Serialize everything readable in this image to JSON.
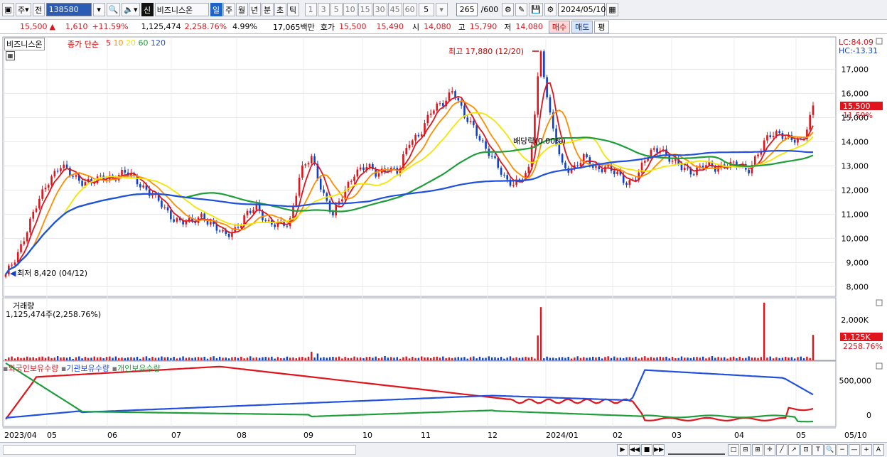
{
  "toolbar": {
    "period_unit": "주",
    "prev_label": "전",
    "code": "138580",
    "stock_name_badge": "신",
    "stock_name": "비즈니스온",
    "periods": [
      "일",
      "주",
      "월",
      "년",
      "분",
      "초",
      "틱"
    ],
    "selected_period": "일",
    "intervals": [
      "1",
      "3",
      "5",
      "10",
      "15",
      "30",
      "45",
      "60"
    ],
    "interval_value": "5",
    "count_value": "265",
    "count_total": "/600",
    "date": "2024/05/10"
  },
  "quote": {
    "price": "15,500",
    "up_arrow": "▲",
    "change": "1,610",
    "change_pct": "+11.59%",
    "volume": "1,125,474",
    "volume_pct": "2,258.76%",
    "turnover_pct": "4.99%",
    "amount": "17,065백만",
    "ask_label": "호가",
    "ask": "15,500",
    "bid": "15,490",
    "open_label": "시",
    "open": "14,080",
    "high_label": "고",
    "high": "15,790",
    "low_label": "저",
    "low": "14,080",
    "buy_label": "매수",
    "sell_label": "매도",
    "eval_label": "평"
  },
  "price_panel": {
    "stock_label": "비즈니스온",
    "ma_title": "종가 단순",
    "ma_periods": [
      "5",
      "10",
      "20",
      "60",
      "120"
    ],
    "ma_colors": [
      "#e0141c",
      "#ff8c00",
      "#f2e600",
      "#1e9e3a",
      "#2050e0"
    ],
    "lc": "LC:84.09",
    "hc": "HC:-13.31",
    "max_note": "최고 17,880 (12/20)",
    "min_note": "최저 8,420 (04/12)",
    "dividend_note": "배당락(0.00%)",
    "last_price_tag": "15,500",
    "last_pct_tag": "11.59%",
    "y_ticks": [
      "17,000",
      "16,000",
      "15,000",
      "14,000",
      "13,000",
      "12,000",
      "11,000",
      "10,000",
      "9,000",
      "8,000"
    ]
  },
  "volume_panel": {
    "title": "거래량",
    "value_text": "1,125,474주(2,258.76%)",
    "y_tick": "2,000K",
    "last_tag": "1,125K",
    "last_pct": "2258.76%"
  },
  "holdings_panel": {
    "legend": [
      "외국인보유수량",
      "기관보유수량",
      "개인보유수량"
    ],
    "legend_colors": [
      "#e0141c",
      "#2050e0",
      "#1e9e3a"
    ],
    "y_ticks": [
      "500,000",
      "0"
    ]
  },
  "x_axis": [
    "2023/04",
    "05",
    "06",
    "07",
    "08",
    "09",
    "10",
    "11",
    "12",
    "2024/01",
    "02",
    "03",
    "04",
    "05",
    "05/10"
  ],
  "chart_data": {
    "type": "candlestick",
    "ylim": [
      7600,
      18100
    ],
    "close_approx": [
      8420,
      9300,
      10400,
      11500,
      12500,
      13000,
      12600,
      12400,
      12300,
      12500,
      12600,
      12700,
      12400,
      12000,
      11500,
      11000,
      10700,
      10600,
      11000,
      10500,
      10100,
      10400,
      10900,
      11300,
      10700,
      10500,
      10600,
      12800,
      13300,
      12000,
      11000,
      11800,
      12800,
      13000,
      12600,
      13000,
      12700,
      14000,
      14400,
      15200,
      15600,
      16200,
      15000,
      14600,
      13700,
      13000,
      12400,
      12300,
      12800,
      17880,
      14700,
      13000,
      12900,
      13300,
      12900,
      13000,
      12600,
      12300,
      12700,
      13500,
      13800,
      13200,
      12900,
      12800,
      13000,
      12900,
      13100,
      13000,
      12800,
      13600,
      14200,
      14400,
      14100,
      13900,
      15500
    ],
    "series": [
      {
        "name": "종가 단순 5"
      },
      {
        "name": "종가 단순 10"
      },
      {
        "name": "종가 단순 20"
      },
      {
        "name": "종가 단순 60"
      },
      {
        "name": "종가 단순 120"
      }
    ]
  }
}
